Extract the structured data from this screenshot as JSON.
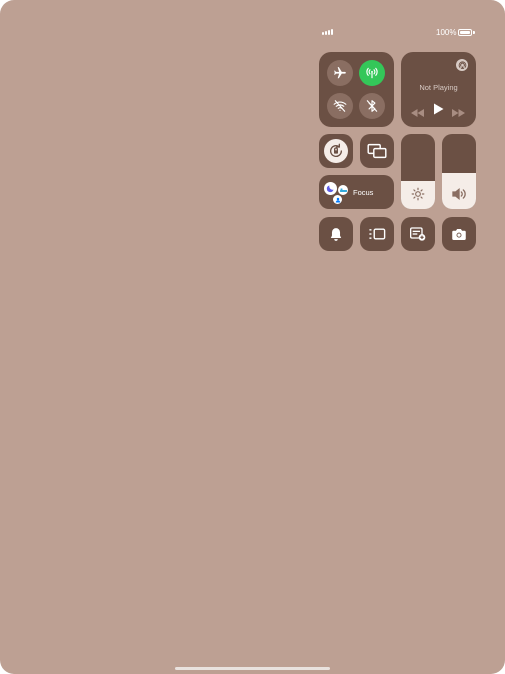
{
  "status_bar": {
    "battery_text": "100%"
  },
  "now_playing": {
    "title": "Not Playing"
  },
  "focus": {
    "label": "Focus"
  },
  "sliders": {
    "brightness_level": 0.38,
    "volume_level": 0.48
  },
  "connectivity": {
    "airplane": "airplane-icon",
    "cellular": "cellular-icon",
    "wifi": "wifi-off-icon",
    "bluetooth": "bluetooth-icon"
  },
  "colors": {
    "background": "#bda093",
    "tile": "#6b5044",
    "active_green": "#34c759",
    "slider_fill": "#f5ede8"
  }
}
